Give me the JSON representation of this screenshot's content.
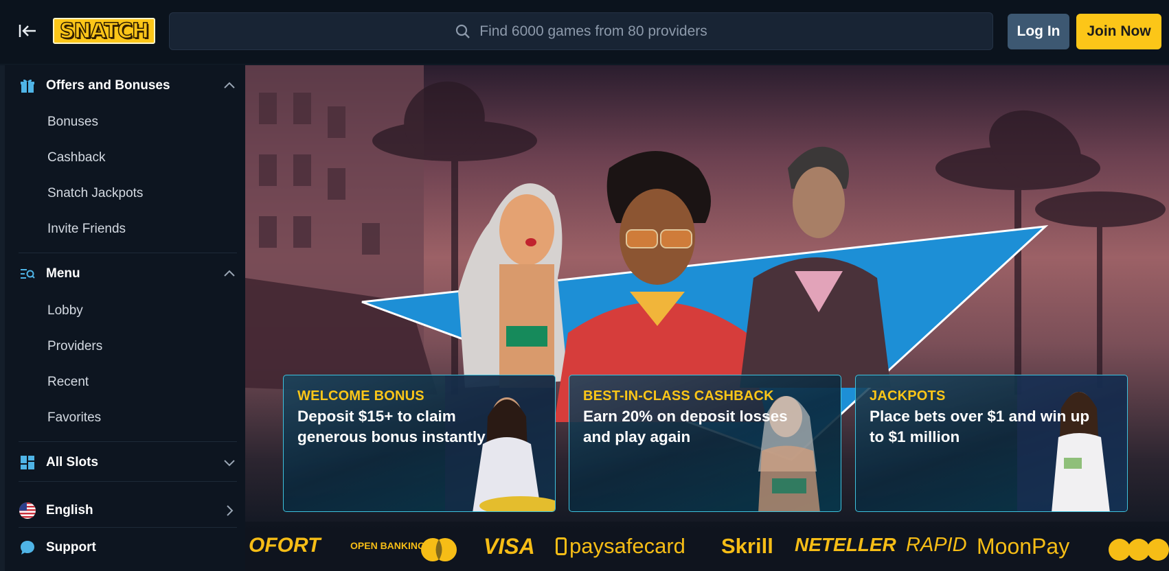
{
  "header": {
    "search_placeholder": "Find 6000 games from 80 providers",
    "login_label": "Log In",
    "join_label": "Join Now",
    "logo_text": "SNATCH"
  },
  "sidebar": {
    "offers": {
      "label": "Offers and Bonuses",
      "items": [
        "Bonuses",
        "Cashback",
        "Snatch Jackpots",
        "Invite Friends"
      ]
    },
    "menu": {
      "label": "Menu",
      "items": [
        "Lobby",
        "Providers",
        "Recent",
        "Favorites"
      ]
    },
    "all_slots": {
      "label": "All Slots"
    },
    "language": {
      "label": "English"
    },
    "support": {
      "label": "Support"
    }
  },
  "promos": [
    {
      "kicker": "WELCOME BONUS",
      "body": "Deposit $15+ to claim generous bonus instantly"
    },
    {
      "kicker": "BEST-IN-CLASS CASHBACK",
      "body": "Earn 20% on deposit losses and play again"
    },
    {
      "kicker": "JACKPOTS",
      "body": "Place bets over $1 and win up to $1 million"
    }
  ],
  "payments": [
    "OFORT",
    "OPEN BANKING",
    "VISA",
    "paysafecard",
    "Skrill",
    "NETELLER",
    "RAPID",
    "MoonPay"
  ],
  "colors": {
    "accent": "#fcc618",
    "login": "#3d5872",
    "card_border": "#3ec3df"
  }
}
